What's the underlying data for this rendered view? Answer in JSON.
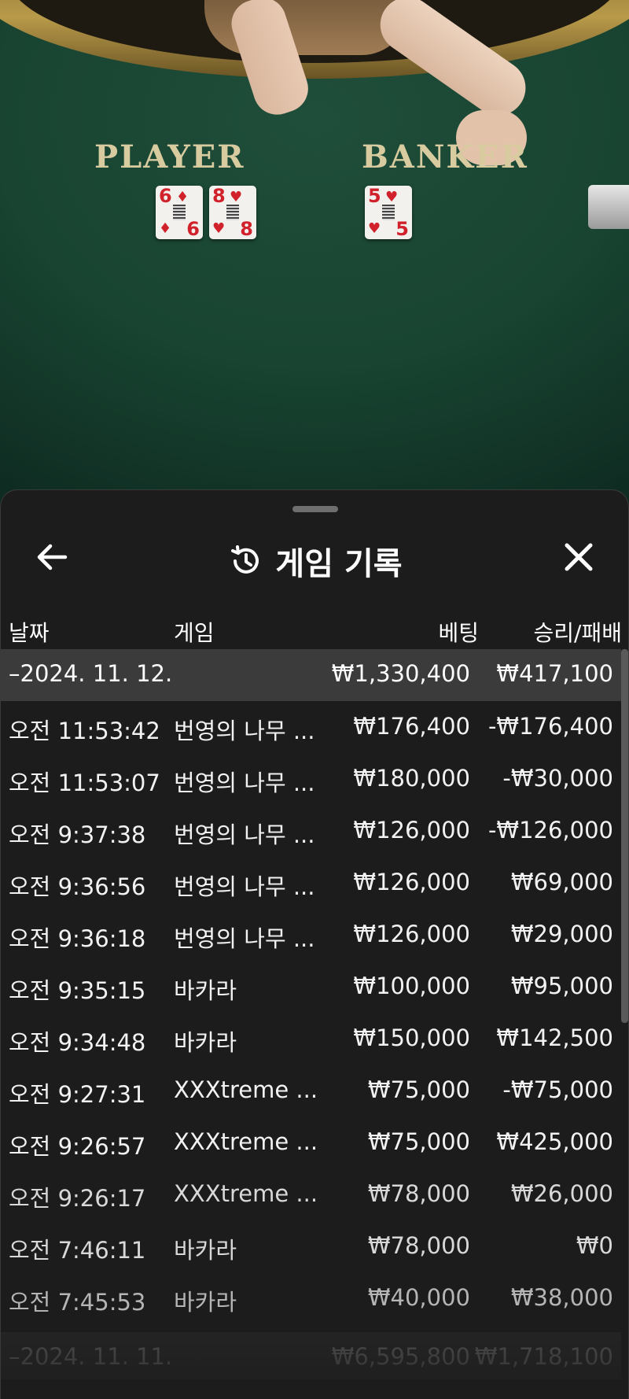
{
  "table": {
    "player_label": "PLAYER",
    "banker_label": "BANKER",
    "player_cards": [
      {
        "rank": "6",
        "suit": "♦"
      },
      {
        "rank": "8",
        "suit": "♥"
      }
    ],
    "banker_cards": [
      {
        "rank": "5",
        "suit": "♥"
      }
    ]
  },
  "sheet": {
    "title": "게임 기록",
    "icons": {
      "back": "arrow-left-icon",
      "history": "history-icon",
      "close": "close-icon"
    },
    "columns": {
      "date": "날짜",
      "game": "게임",
      "bet": "베팅",
      "result": "승리/패배"
    },
    "groups": [
      {
        "date": "–2024. 11. 12.",
        "bet": "₩1,330,400",
        "result": "₩417,100",
        "rows": [
          {
            "time": "오전 11:53:42",
            "game": "번영의 나무 ...",
            "bet": "₩176,400",
            "result": "-₩176,400"
          },
          {
            "time": "오전 11:53:07",
            "game": "번영의 나무 ...",
            "bet": "₩180,000",
            "result": "-₩30,000"
          },
          {
            "time": "오전 9:37:38",
            "game": "번영의 나무 ...",
            "bet": "₩126,000",
            "result": "-₩126,000"
          },
          {
            "time": "오전 9:36:56",
            "game": "번영의 나무 ...",
            "bet": "₩126,000",
            "result": "₩69,000"
          },
          {
            "time": "오전 9:36:18",
            "game": "번영의 나무 ...",
            "bet": "₩126,000",
            "result": "₩29,000"
          },
          {
            "time": "오전 9:35:15",
            "game": "바카라",
            "bet": "₩100,000",
            "result": "₩95,000"
          },
          {
            "time": "오전 9:34:48",
            "game": "바카라",
            "bet": "₩150,000",
            "result": "₩142,500"
          },
          {
            "time": "오전 9:27:31",
            "game": "XXXtreme ...",
            "bet": "₩75,000",
            "result": "-₩75,000"
          },
          {
            "time": "오전 9:26:57",
            "game": "XXXtreme ...",
            "bet": "₩75,000",
            "result": "₩425,000"
          },
          {
            "time": "오전 9:26:17",
            "game": "XXXtreme ...",
            "bet": "₩78,000",
            "result": "₩26,000"
          },
          {
            "time": "오전 7:46:11",
            "game": "바카라",
            "bet": "₩78,000",
            "result": "₩0"
          },
          {
            "time": "오전 7:45:53",
            "game": "바카라",
            "bet": "₩40,000",
            "result": "₩38,000"
          }
        ]
      },
      {
        "date": "–2024. 11. 11.",
        "bet": "₩6,595,800",
        "result": "₩1,718,100",
        "rows": []
      }
    ]
  },
  "colors": {
    "sheet_bg": "#1c1c1c",
    "group_row_bg": "#3b3b3b",
    "felt": "#184431",
    "table_label": "#d8cba0",
    "card_red": "#d1222b"
  }
}
